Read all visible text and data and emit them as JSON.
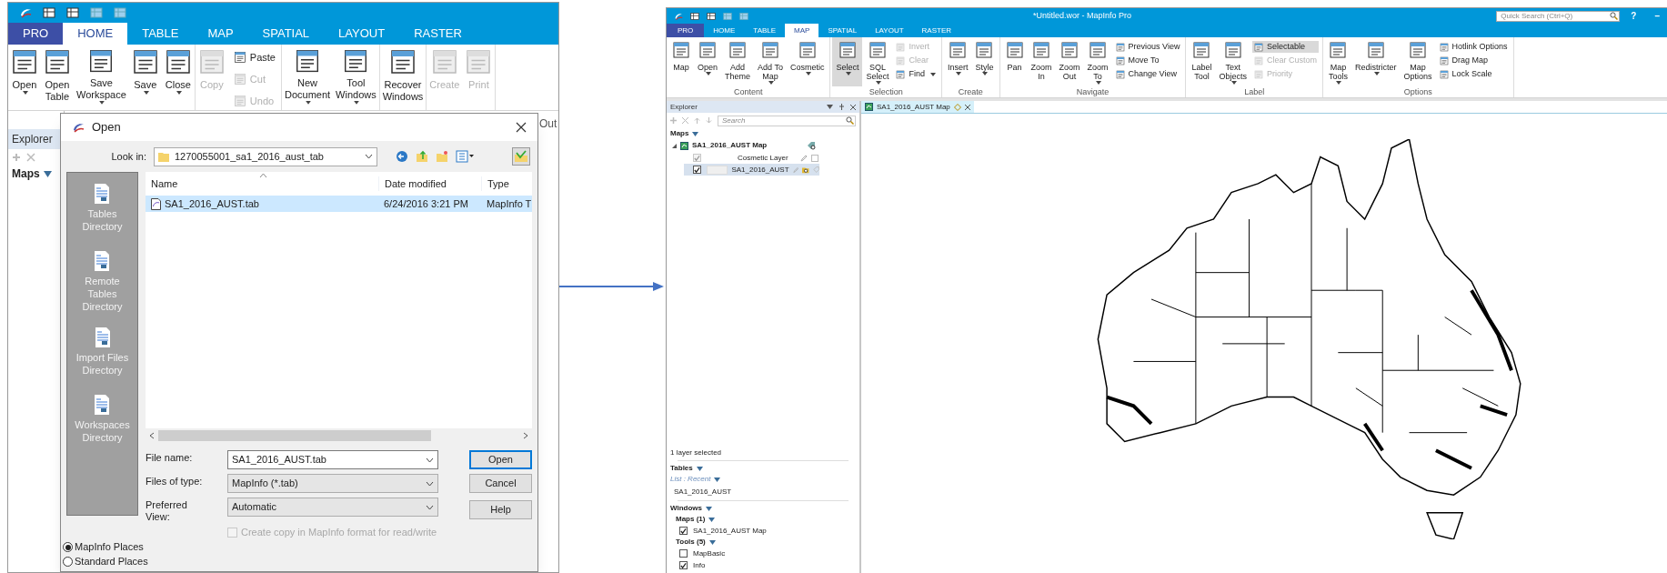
{
  "left_window": {
    "tabs": [
      {
        "label": "PRO",
        "kind": "backstage",
        "selected": false
      },
      {
        "label": "HOME",
        "kind": "tab",
        "selected": true
      },
      {
        "label": "TABLE",
        "kind": "tab",
        "selected": false
      },
      {
        "label": "MAP",
        "kind": "tab",
        "selected": false
      },
      {
        "label": "SPATIAL",
        "kind": "tab",
        "selected": false
      },
      {
        "label": "LAYOUT",
        "kind": "tab",
        "selected": false
      },
      {
        "label": "RASTER",
        "kind": "tab",
        "selected": false
      }
    ],
    "ribbon": {
      "groups": [
        {
          "items": [
            {
              "kind": "large",
              "label": "Open",
              "dropdown": true,
              "disabled": false,
              "pressed": false
            },
            {
              "kind": "large",
              "label": "Open\nTable",
              "dropdown": false,
              "disabled": false,
              "pressed": false
            },
            {
              "kind": "large",
              "label": "Save\nWorkspace",
              "dropdown": true,
              "disabled": false,
              "pressed": false
            },
            {
              "kind": "large",
              "label": "Save",
              "dropdown": true,
              "disabled": false,
              "pressed": false
            },
            {
              "kind": "large",
              "label": "Close",
              "dropdown": true,
              "disabled": false,
              "pressed": false
            }
          ]
        },
        {
          "items": [
            {
              "kind": "large",
              "label": "Copy",
              "dropdown": false,
              "disabled": true,
              "pressed": false
            },
            {
              "kind": "stack",
              "items": [
                {
                  "label": "Paste",
                  "dropdown": false,
                  "disabled": false,
                  "pressed": false
                },
                {
                  "label": "Cut",
                  "dropdown": false,
                  "disabled": true,
                  "pressed": false
                },
                {
                  "label": "Undo",
                  "dropdown": false,
                  "disabled": true,
                  "pressed": false
                }
              ]
            }
          ]
        },
        {
          "items": [
            {
              "kind": "large",
              "label": "New\nDocument",
              "dropdown": true,
              "disabled": false,
              "pressed": false
            },
            {
              "kind": "large",
              "label": "Tool\nWindows",
              "dropdown": true,
              "disabled": false,
              "pressed": false
            }
          ]
        },
        {
          "items": [
            {
              "kind": "large",
              "label": "Recover\nWindows",
              "dropdown": false,
              "disabled": false,
              "pressed": false
            }
          ]
        },
        {
          "items": [
            {
              "kind": "large",
              "label": "Create",
              "dropdown": false,
              "disabled": true,
              "pressed": false
            },
            {
              "kind": "large",
              "label": "Print",
              "dropdown": false,
              "disabled": true,
              "pressed": false
            }
          ]
        }
      ]
    },
    "cut_label": "Out",
    "explorer": {
      "tab": "Explorer",
      "section": "Maps"
    },
    "dialog": {
      "title": "Open",
      "look_in_label": "Look in:",
      "look_in_value": "1270055001_sa1_2016_aust_tab",
      "places": [
        {
          "label": "Tables\nDirectory"
        },
        {
          "label": "Remote\nTables\nDirectory"
        },
        {
          "label": "Import Files\nDirectory"
        },
        {
          "label": "Workspaces\nDirectory"
        }
      ],
      "columns": [
        "Name",
        "Date modified",
        "Type"
      ],
      "rows": [
        {
          "cells": [
            "SA1_2016_AUST.tab",
            "6/24/2016 3:21 PM",
            "MapInfo T"
          ],
          "selected": true
        }
      ],
      "file_name_label": "File name:",
      "file_name_value": "SA1_2016_AUST.tab",
      "files_of_type_label": "Files of type:",
      "files_of_type_value": "MapInfo (*.tab)",
      "preferred_view_label": "Preferred\nView:",
      "preferred_view_value": "Automatic",
      "copy_checkbox": {
        "label": "Create copy in MapInfo format for read/write",
        "checked": false,
        "disabled": true
      },
      "buttons": [
        {
          "label": "Open",
          "default": true
        },
        {
          "label": "Cancel",
          "default": false
        },
        {
          "label": "Help",
          "default": false
        }
      ],
      "place_options": [
        {
          "label": "MapInfo Places",
          "selected": true
        },
        {
          "label": "Standard Places",
          "selected": false
        }
      ]
    }
  },
  "right_window": {
    "title": "*Untitled.wor - MapInfo Pro",
    "quick_search": {
      "placeholder": "Quick Search (Ctrl+Q)"
    },
    "help": "?",
    "minimize": "–",
    "tabs": [
      {
        "label": "PRO",
        "kind": "backstage",
        "selected": false
      },
      {
        "label": "HOME",
        "kind": "tab",
        "selected": false
      },
      {
        "label": "TABLE",
        "kind": "tab",
        "selected": false
      },
      {
        "label": "MAP",
        "kind": "tab",
        "selected": true
      },
      {
        "label": "SPATIAL",
        "kind": "tab",
        "selected": false
      },
      {
        "label": "LAYOUT",
        "kind": "tab",
        "selected": false
      },
      {
        "label": "RASTER",
        "kind": "tab",
        "selected": false
      }
    ],
    "ribbon": {
      "groups": [
        {
          "label": "Content",
          "items": [
            {
              "kind": "large",
              "label": "Map",
              "dropdown": false,
              "disabled": false,
              "pressed": false
            },
            {
              "kind": "large",
              "label": "Open",
              "dropdown": true,
              "disabled": false,
              "pressed": false
            },
            {
              "kind": "large",
              "label": "Add\nTheme",
              "dropdown": false,
              "disabled": false,
              "pressed": false
            },
            {
              "kind": "large",
              "label": "Add To\nMap",
              "dropdown": true,
              "disabled": false,
              "pressed": false
            },
            {
              "kind": "large",
              "label": "Cosmetic",
              "dropdown": true,
              "disabled": false,
              "pressed": false
            }
          ]
        },
        {
          "label": "Selection",
          "items": [
            {
              "kind": "large",
              "label": "Select",
              "dropdown": true,
              "disabled": false,
              "pressed": true
            },
            {
              "kind": "large",
              "label": "SQL\nSelect",
              "dropdown": true,
              "disabled": false,
              "pressed": false
            },
            {
              "kind": "stack",
              "items": [
                {
                  "label": "Invert",
                  "dropdown": false,
                  "disabled": true,
                  "pressed": false
                },
                {
                  "label": "Clear",
                  "dropdown": false,
                  "disabled": true,
                  "pressed": false
                },
                {
                  "label": "Find",
                  "dropdown": true,
                  "disabled": false,
                  "pressed": false
                }
              ]
            }
          ]
        },
        {
          "label": "Create",
          "items": [
            {
              "kind": "large",
              "label": "Insert",
              "dropdown": true,
              "disabled": false,
              "pressed": false
            },
            {
              "kind": "large",
              "label": "Style",
              "dropdown": true,
              "disabled": false,
              "pressed": false
            }
          ]
        },
        {
          "label": "Navigate",
          "items": [
            {
              "kind": "large",
              "label": "Pan",
              "dropdown": false,
              "disabled": false,
              "pressed": false
            },
            {
              "kind": "large",
              "label": "Zoom\nIn",
              "dropdown": false,
              "disabled": false,
              "pressed": false
            },
            {
              "kind": "large",
              "label": "Zoom\nOut",
              "dropdown": false,
              "disabled": false,
              "pressed": false
            },
            {
              "kind": "large",
              "label": "Zoom\nTo",
              "dropdown": true,
              "disabled": false,
              "pressed": false
            },
            {
              "kind": "stack",
              "items": [
                {
                  "label": "Previous View",
                  "dropdown": false,
                  "disabled": false,
                  "pressed": false
                },
                {
                  "label": "Move To",
                  "dropdown": false,
                  "disabled": false,
                  "pressed": false
                },
                {
                  "label": "Change View",
                  "dropdown": false,
                  "disabled": false,
                  "pressed": false
                }
              ]
            }
          ]
        },
        {
          "label": "Label",
          "items": [
            {
              "kind": "large",
              "label": "Label\nTool",
              "dropdown": false,
              "disabled": false,
              "pressed": false
            },
            {
              "kind": "large",
              "label": "Text\nObjects",
              "dropdown": true,
              "disabled": false,
              "pressed": false
            },
            {
              "kind": "stack",
              "items": [
                {
                  "label": "Selectable",
                  "dropdown": false,
                  "disabled": false,
                  "pressed": true
                },
                {
                  "label": "Clear Custom",
                  "dropdown": false,
                  "disabled": true,
                  "pressed": false
                },
                {
                  "label": "Priority",
                  "dropdown": false,
                  "disabled": true,
                  "pressed": false
                }
              ]
            }
          ]
        },
        {
          "label": "Options",
          "items": [
            {
              "kind": "large",
              "label": "Map\nTools",
              "dropdown": true,
              "disabled": false,
              "pressed": false
            },
            {
              "kind": "large",
              "label": "Redistricter",
              "dropdown": true,
              "disabled": false,
              "pressed": false
            },
            {
              "kind": "large",
              "label": "Map\nOptions",
              "dropdown": false,
              "disabled": false,
              "pressed": false
            },
            {
              "kind": "stack",
              "items": [
                {
                  "label": "Hotlink Options",
                  "dropdown": false,
                  "disabled": false,
                  "pressed": false
                },
                {
                  "label": "Drag Map",
                  "dropdown": false,
                  "disabled": false,
                  "pressed": false
                },
                {
                  "label": "Lock Scale",
                  "dropdown": false,
                  "disabled": false,
                  "pressed": false
                }
              ]
            }
          ]
        }
      ]
    },
    "explorer": {
      "title": "Explorer",
      "search": {
        "placeholder": "Search"
      },
      "maps_heading": "Maps",
      "maps": [
        {
          "label": "SA1_2016_AUST Map",
          "expanded": true,
          "children": [
            {
              "label": "Cosmetic Layer",
              "kind": "cosmetic",
              "checked": true,
              "selected": false
            },
            {
              "label": "SA1_2016_AUST",
              "kind": "layer",
              "checked": true,
              "selected": true
            }
          ]
        }
      ],
      "status": "1 layer selected",
      "tables_heading": "Tables",
      "tables_filter": "List : Recent",
      "tables": [
        "SA1_2016_AUST"
      ],
      "windows_heading": "Windows",
      "window_groups": [
        {
          "label": "**Maps** (1)",
          "items": [
            {
              "label": "SA1_2016_AUST Map",
              "checked": true
            }
          ]
        },
        {
          "label": "**Tools** (5)",
          "items": [
            {
              "label": "MapBasic",
              "checked": false
            },
            {
              "label": "Info",
              "checked": true
            }
          ]
        }
      ]
    },
    "document_tab": {
      "label": "SA1_2016_AUST Map"
    }
  }
}
